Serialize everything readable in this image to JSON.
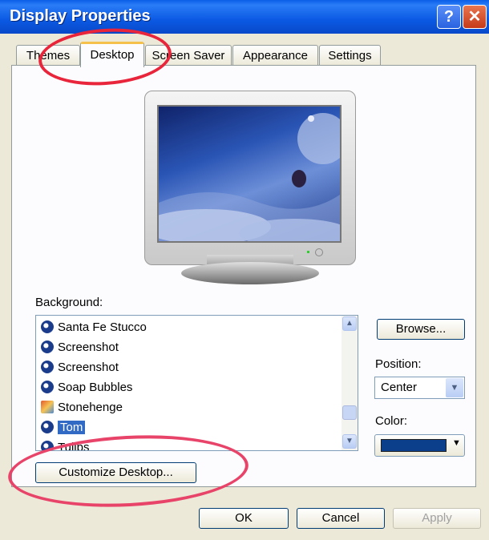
{
  "window": {
    "title": "Display Properties",
    "help_label": "?",
    "close_label": "✕"
  },
  "tabs": [
    {
      "label": "Themes"
    },
    {
      "label": "Desktop"
    },
    {
      "label": "Screen Saver"
    },
    {
      "label": "Appearance"
    },
    {
      "label": "Settings"
    }
  ],
  "background": {
    "label": "Background:",
    "items": [
      {
        "label": "Santa Fe Stucco",
        "icon": "wallpaper-icon"
      },
      {
        "label": "Screenshot",
        "icon": "wallpaper-icon"
      },
      {
        "label": "Screenshot",
        "icon": "wallpaper-icon"
      },
      {
        "label": "Soap Bubbles",
        "icon": "wallpaper-icon"
      },
      {
        "label": "Stonehenge",
        "icon": "image-file-icon"
      },
      {
        "label": "Tom",
        "icon": "wallpaper-icon",
        "selected": true
      },
      {
        "label": "Tulips",
        "icon": "wallpaper-icon"
      }
    ]
  },
  "browse_label": "Browse...",
  "position": {
    "label": "Position:",
    "value": "Center"
  },
  "color": {
    "label": "Color:",
    "value": "#0b3f8c"
  },
  "customize_label": "Customize Desktop...",
  "footer": {
    "ok_label": "OK",
    "cancel_label": "Cancel",
    "apply_label": "Apply"
  },
  "colors": {
    "titlebar": "#0b59e3",
    "selection": "#316ac5",
    "annotation": "#e8253a"
  }
}
